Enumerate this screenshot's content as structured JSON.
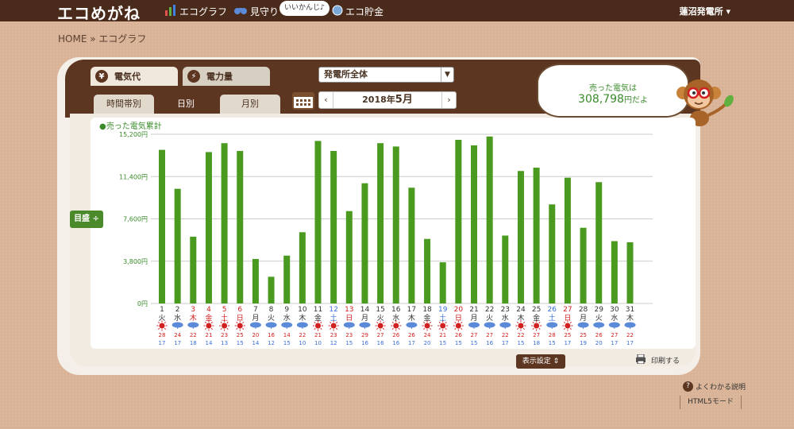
{
  "header": {
    "logo": "エコめがね",
    "nav": [
      {
        "label": "エコグラフ",
        "icon": "bar-chart-icon"
      },
      {
        "label": "見守り",
        "icon": "binoculars-icon"
      },
      {
        "label": "エコ貯金",
        "icon": "coin-icon"
      }
    ],
    "bubble": "いいかんじ♪",
    "plant": "蓮沼発電所 ▾"
  },
  "breadcrumb": "HOME » エコグラフ",
  "tabs": {
    "money": "電気代",
    "money_icon": "¥",
    "power": "電力量",
    "power_icon": "⚡"
  },
  "plant_select": "発電所全体",
  "period_tabs": [
    "時間帯別",
    "日別",
    "月別"
  ],
  "date": {
    "prefix": "2018年",
    "month": "5月",
    "prev": "‹",
    "next": "›"
  },
  "speech": {
    "line1": "売った電気は",
    "amount": "308,798",
    "suffix": "円だよ"
  },
  "legend": "●売った電気累計",
  "target_button": "目盛 ÷",
  "display_settings": "表示設定 ⇕",
  "print": "印刷する",
  "help": "よくわかる説明",
  "html5": "HTML5モード",
  "colors": {
    "bar": "#4a9a20",
    "sat": "#3a6fd8",
    "sun": "#d02020",
    "brown": "#5c3620"
  },
  "chart_data": {
    "type": "bar",
    "ylim": [
      0,
      15200
    ],
    "y_ticks": [
      "0円",
      "3,800円",
      "7,600円",
      "11,400円",
      "15,200円"
    ],
    "y_tick_values": [
      0,
      3800,
      7600,
      11400,
      15200
    ],
    "days": [
      "1",
      "2",
      "3",
      "4",
      "5",
      "6",
      "7",
      "8",
      "9",
      "10",
      "11",
      "12",
      "13",
      "14",
      "15",
      "16",
      "17",
      "18",
      "19",
      "20",
      "21",
      "22",
      "23",
      "24",
      "25",
      "26",
      "27",
      "28",
      "29",
      "30",
      "31"
    ],
    "weekdays": [
      "火",
      "水",
      "木",
      "金",
      "土",
      "日",
      "月",
      "火",
      "水",
      "木",
      "金",
      "土",
      "日",
      "月",
      "火",
      "水",
      "木",
      "金",
      "土",
      "日",
      "月",
      "火",
      "水",
      "木",
      "金",
      "土",
      "日",
      "月",
      "火",
      "水",
      "木"
    ],
    "day_colors": [
      "n",
      "n",
      "h",
      "h",
      "h",
      "h",
      "n",
      "n",
      "n",
      "n",
      "n",
      "s",
      "h",
      "n",
      "n",
      "n",
      "n",
      "n",
      "s",
      "h",
      "n",
      "n",
      "n",
      "n",
      "n",
      "s",
      "h",
      "n",
      "n",
      "n",
      "n"
    ],
    "values": [
      13800,
      10300,
      6000,
      13600,
      14400,
      13700,
      4000,
      2400,
      4300,
      6400,
      14600,
      13700,
      8300,
      10800,
      14400,
      14100,
      10400,
      5800,
      3700,
      14700,
      14200,
      15000,
      6100,
      11900,
      12200,
      8900,
      11300,
      6800,
      10900,
      5600,
      5500
    ],
    "weather": [
      "sun",
      "rain",
      "rain",
      "sun",
      "sun",
      "sun",
      "rain",
      "rain",
      "rain",
      "rain",
      "sun",
      "sun",
      "rain",
      "rain",
      "sun",
      "sun",
      "rain",
      "sun",
      "sun",
      "sun",
      "rain",
      "rain",
      "rain",
      "sun",
      "sun",
      "rain",
      "sun",
      "rain",
      "rain",
      "rain",
      "rain"
    ],
    "high": [
      "28",
      "24",
      "22",
      "21",
      "23",
      "25",
      "20",
      "16",
      "14",
      "22",
      "21",
      "23",
      "23",
      "29",
      "27",
      "26",
      "26",
      "24",
      "21",
      "26",
      "27",
      "27",
      "22",
      "22",
      "27",
      "28",
      "25",
      "25",
      "26",
      "27",
      "22"
    ],
    "low": [
      "17",
      "17",
      "18",
      "14",
      "13",
      "15",
      "14",
      "12",
      "15",
      "10",
      "10",
      "12",
      "15",
      "16",
      "16",
      "16",
      "17",
      "20",
      "15",
      "15",
      "15",
      "16",
      "17",
      "15",
      "18",
      "15",
      "17",
      "19",
      "20",
      "17",
      "17"
    ]
  }
}
